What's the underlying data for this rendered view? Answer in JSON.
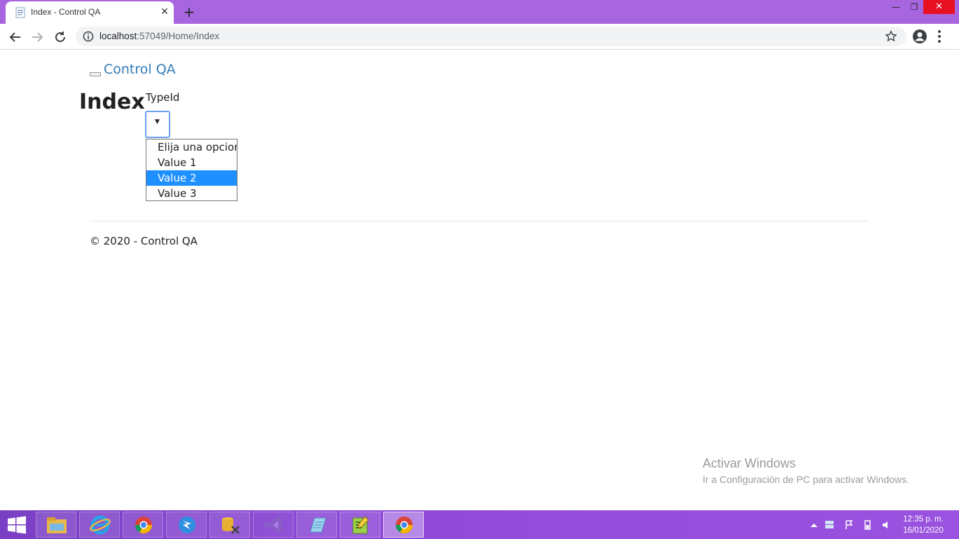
{
  "browser": {
    "tab_title": "Index - Control QA",
    "tab_close": "✕",
    "new_tab": "+",
    "url_host": "localhost",
    "url_rest": ":57049/Home/Index",
    "window_min": "—",
    "window_max": "❐",
    "window_close": "✕"
  },
  "page": {
    "brand": "Control QA",
    "title": "Index",
    "field_label": "TypeId",
    "dropdown_options": [
      {
        "label": "Elija una opcion",
        "selected": false
      },
      {
        "label": "Value 1",
        "selected": false
      },
      {
        "label": "Value 2",
        "selected": true
      },
      {
        "label": "Value 3",
        "selected": false
      }
    ],
    "footer": "© 2020 - Control QA"
  },
  "os": {
    "watermark_title": "Activar Windows",
    "watermark_subtitle": "Ir a Configuración de PC para activar Windows.",
    "clock_time": "12:35 p. m.",
    "clock_date": "16/01/2020",
    "taskbar_apps": [
      "file-explorer-icon",
      "internet-explorer-icon",
      "chrome-icon",
      "dbeaver-icon",
      "sql-tool-icon",
      "visual-studio-icon",
      "notepad-icon",
      "notepad-plus-icon",
      "chrome-icon"
    ]
  },
  "colors": {
    "chrome_frame": "#a766e0",
    "link": "#337ab7",
    "selected_option": "#1e90ff",
    "taskbar": "#8f4bd8"
  }
}
